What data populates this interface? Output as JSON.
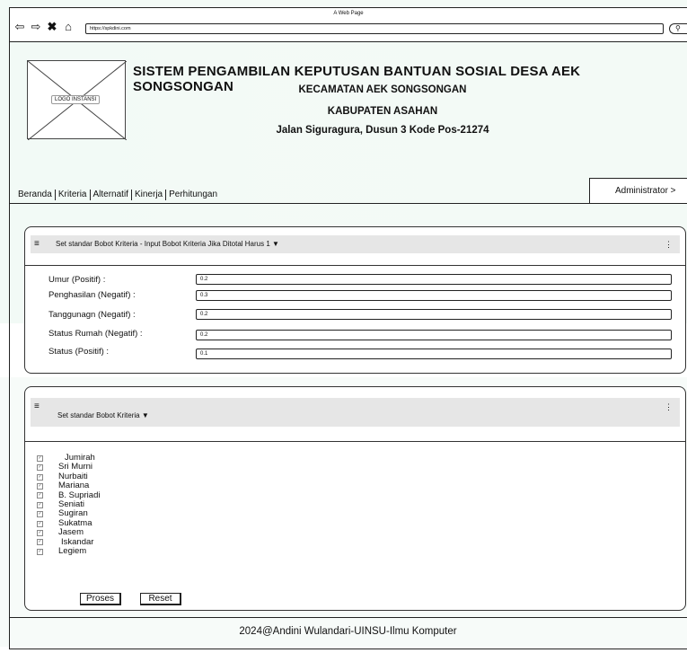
{
  "window": {
    "title": "A Web Page",
    "url": "https://spkdini.com"
  },
  "icons": {
    "back": "back-arrow-icon",
    "forward": "forward-arrow-icon",
    "close": "close-icon",
    "home": "home-icon",
    "search": "search-icon",
    "menu": "hamburger-menu-icon",
    "more": "kebab-menu-icon",
    "dropdown": "caret-down-icon",
    "checkbox": "checkbox-icon"
  },
  "logo": {
    "label": "LOGO INSTANSI"
  },
  "header": {
    "title": "SISTEM PENGAMBILAN KEPUTUSAN BANTUAN SOSIAL DESA AEK SONGSONGAN",
    "line1": "KECAMATAN AEK SONGSONGAN",
    "line2": "KABUPATEN ASAHAN",
    "line3": "Jalan Siguragura, Dusun 3 Kode Pos-21274"
  },
  "menu": {
    "items": [
      "Beranda",
      "Kriteria",
      "Alternatif",
      "Kinerja",
      "Perhitungan"
    ],
    "admin": "Administrator >"
  },
  "panel1": {
    "title": "Set standar Bobot Kriteria - Input Bobot Kriteria Jika Ditotal Harus 1",
    "fields": [
      {
        "label": "Umur (Positif)   :",
        "value": "0.2"
      },
      {
        "label": "Penghasilan (Negatif)  :",
        "value": "0.3"
      },
      {
        "label": "Tanggunagn (Negatif)  :",
        "value": "0.2"
      },
      {
        "label": "Status Rumah (Negatif)  :",
        "value": "0.2"
      },
      {
        "label": "Status (Positif)   :",
        "value": "0.1"
      }
    ]
  },
  "panel2": {
    "title": "Set standar Bobot Kriteria",
    "people": [
      "Jumirah",
      "Sri Murni",
      "Nurbaiti",
      "Mariana",
      "B. Supriadi",
      "Seniati",
      "Sugiran",
      "Sukatma",
      "Jasem",
      "Iskandar",
      "Legiem"
    ],
    "buttons": {
      "proses": "Proses",
      "reset": "Reset"
    }
  },
  "footer": {
    "text": "2024@Andini Wulandari-UINSU-Ilmu Komputer"
  }
}
